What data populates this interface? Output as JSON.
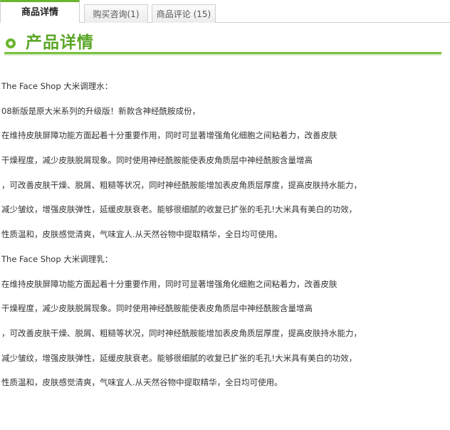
{
  "tabs": [
    {
      "label": "商品详情"
    },
    {
      "label": "购买咨询(1)"
    },
    {
      "label": "商品评论 (15)"
    }
  ],
  "section": {
    "title": "产品详情"
  },
  "description": {
    "lines": [
      "The Face Shop 大米调理水：",
      "08新版是原大米系列的升级版！新款含神经酰胺成份，",
      "在维持皮肤屏障功能方面起着十分重要作用，同时可显著增强角化细胞之间粘着力，改善皮肤",
      "干燥程度，减少皮肤脱屑现象。同时使用神经酰胺能使表皮角质层中神经酰胺含量增高",
      "，可改善皮肤干燥、脱屑、粗糙等状况，同时神经酰胺能增加表皮角质层厚度，提高皮肤持水能力，",
      "减少皱纹，增强皮肤弹性，延缓皮肤衰老。能够很细腻的收复已扩张的毛孔!大米具有美白的功效，",
      "性质温和，皮肤感觉清爽，气味宜人.从天然谷物中提取精华，全日均可使用。",
      "The Face Shop 大米调理乳：",
      "在维持皮肤屏障功能方面起着十分重要作用，同时可显著增强角化细胞之间粘着力，改善皮肤",
      "干燥程度，减少皮肤脱屑现象。同时使用神经酰胺能使表皮角质层中神经酰胺含量增高",
      "，可改善皮肤干燥、脱屑、粗糙等状况，同时神经酰胺能增加表皮角质层厚度，提高皮肤持水能力，",
      "减少皱纹，增强皮肤弹性，延缓皮肤衰老。能够很细腻的收复已扩张的毛孔!大米具有美白的功效，",
      "性质温和，皮肤感觉清爽，气味宜人.从天然谷物中提取精华，全日均可使用。"
    ]
  },
  "colors": {
    "accent": "#6bb52f",
    "title": "#5aa626",
    "rule": "#7cc242",
    "text": "#333333"
  },
  "icons": {
    "section_bullet": "circle-bullet-icon"
  }
}
